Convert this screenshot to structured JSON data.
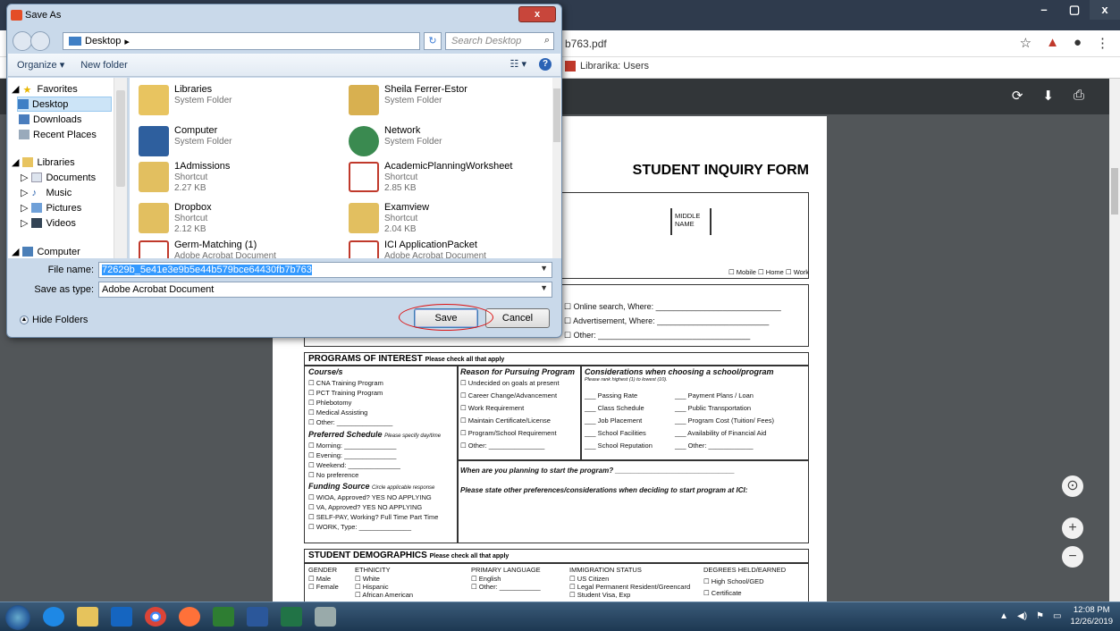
{
  "browser": {
    "url_fragment": "b763.pdf",
    "bookmark_label": "Librarika: Users",
    "window_controls": [
      "–",
      "▢",
      "x"
    ]
  },
  "dialog": {
    "title": "Save As",
    "close_glyph": "x",
    "location": "Desktop",
    "location_arrow": "▸",
    "search_placeholder": "Search Desktop",
    "toolbar": {
      "organize": "Organize ▾",
      "new_folder": "New folder"
    },
    "nav": [
      {
        "label": "Favorites",
        "icon": "star-icon"
      },
      {
        "label": "Desktop",
        "icon": "desktop-icon"
      },
      {
        "label": "Downloads",
        "icon": "downloads-icon"
      },
      {
        "label": "Recent Places",
        "icon": "recent-places-icon"
      },
      {
        "label": "Libraries",
        "icon": "libraries-icon"
      },
      {
        "label": "Documents",
        "icon": "documents-icon"
      },
      {
        "label": "Music",
        "icon": "music-icon"
      },
      {
        "label": "Pictures",
        "icon": "pictures-icon"
      },
      {
        "label": "Videos",
        "icon": "videos-icon"
      },
      {
        "label": "Computer",
        "icon": "computer-icon"
      }
    ],
    "files": [
      {
        "name": "Libraries",
        "line1": "System Folder",
        "line2": ""
      },
      {
        "name": "Sheila Ferrer-Estor",
        "line1": "System Folder",
        "line2": ""
      },
      {
        "name": "Computer",
        "line1": "System Folder",
        "line2": ""
      },
      {
        "name": "Network",
        "line1": "System Folder",
        "line2": ""
      },
      {
        "name": "1Admissions",
        "line1": "Shortcut",
        "line2": "2.27 KB"
      },
      {
        "name": "AcademicPlanningWorksheet",
        "line1": "Shortcut",
        "line2": "2.85 KB"
      },
      {
        "name": "Dropbox",
        "line1": "Shortcut",
        "line2": "2.12 KB"
      },
      {
        "name": "Examview",
        "line1": "Shortcut",
        "line2": "2.04 KB"
      },
      {
        "name": "Germ-Matching (1)",
        "line1": "Adobe Acrobat Document",
        "line2": ""
      },
      {
        "name": "ICI ApplicationPacket",
        "line1": "Adobe Acrobat Document",
        "line2": ""
      }
    ],
    "file_name_label": "File name:",
    "file_name_value": "72629b_5e41e3e9b5e44b579bce64430fb7b763",
    "save_type_label": "Save as type:",
    "save_type_value": "Adobe Acrobat Document",
    "hide_folders": "Hide Folders",
    "save": "Save",
    "cancel": "Cancel"
  },
  "pdf": {
    "title": "STUDENT INQUIRY FORM",
    "middle_name": "MIDDLE NAME",
    "phone_opts": "☐ Mobile ☐ Home ☐ Work",
    "heard": [
      "☐ Online search, Where: ____________________________",
      "☐ Advertisement, Where: _________________________",
      "☐ Other: __________________________________"
    ],
    "programs_title": "PROGRAMS OF INTEREST",
    "check_all": "Please check all that apply",
    "course_head": "Course/s",
    "courses": [
      "☐ CNA Training Program",
      "☐ PCT Training Program",
      "☐ Phlebotomy",
      "☐ Medical Assisting",
      "☐ Other: _______________"
    ],
    "schedule_head": "Preferred Schedule",
    "schedule_note": "Please specify day/time",
    "schedule": [
      "☐ Morning: ______________",
      "☐ Evening: ______________",
      "☐ Weekend: ______________",
      "☐ No preference"
    ],
    "funding_head": "Funding Source",
    "funding_note": "Circle applicable response",
    "funding": [
      "☐ WIOA, Approved? YES NO APPLYING",
      "☐ VA, Approved? YES NO APPLYING",
      "☐ SELF-PAY, Working? Full Time Part Time",
      "☐ WORK, Type: ______________"
    ],
    "reason_head": "Reason for Pursuing Program",
    "reasons": [
      "☐ Undecided on goals at present",
      "☐ Career Change/Advancement",
      "☐ Work Requirement",
      "☐ Maintain Certificate/License",
      "☐ Program/School Requirement",
      "☐ Other: _______________"
    ],
    "consider_head": "Considerations when choosing a school/program",
    "consider_note": "Please rank highest (1) to lowest (10).",
    "consider_left": [
      "___ Passing Rate",
      "___ Class Schedule",
      "___ Job Placement",
      "___ School Facilities",
      "___ School Reputation"
    ],
    "consider_right": [
      "___ Payment Plans / Loan",
      "___ Public Transportation",
      "___ Program Cost (Tuition/ Fees)",
      "___ Availability of Financial Aid",
      "___ Other: ____________"
    ],
    "when_start": "When are you planning to start the program? ______________________________",
    "other_prefs": "Please state other preferences/considerations when deciding to start program at ICI:",
    "demo_title": "STUDENT DEMOGRAPHICS",
    "demo_cols": [
      {
        "head": "GENDER",
        "items": [
          "☐ Male",
          "☐ Female"
        ]
      },
      {
        "head": "ETHNICITY",
        "items": [
          "☐ White",
          "☐ Hispanic",
          "☐ African American"
        ]
      },
      {
        "head": "PRIMARY LANGUAGE",
        "items": [
          "☐ English",
          "☐ Other: ___________"
        ]
      },
      {
        "head": "IMMIGRATION STATUS",
        "items": [
          "☐ US Citizen",
          "☐ Legal Permanent Resident/Greencard",
          "☐ Student Visa, Exp"
        ]
      },
      {
        "head": "DEGREES HELD/EARNED",
        "items": [
          "☐ High School/GED",
          "☐ Certificate"
        ]
      }
    ]
  },
  "taskbar": {
    "time": "12:08 PM",
    "date": "12/26/2019"
  }
}
